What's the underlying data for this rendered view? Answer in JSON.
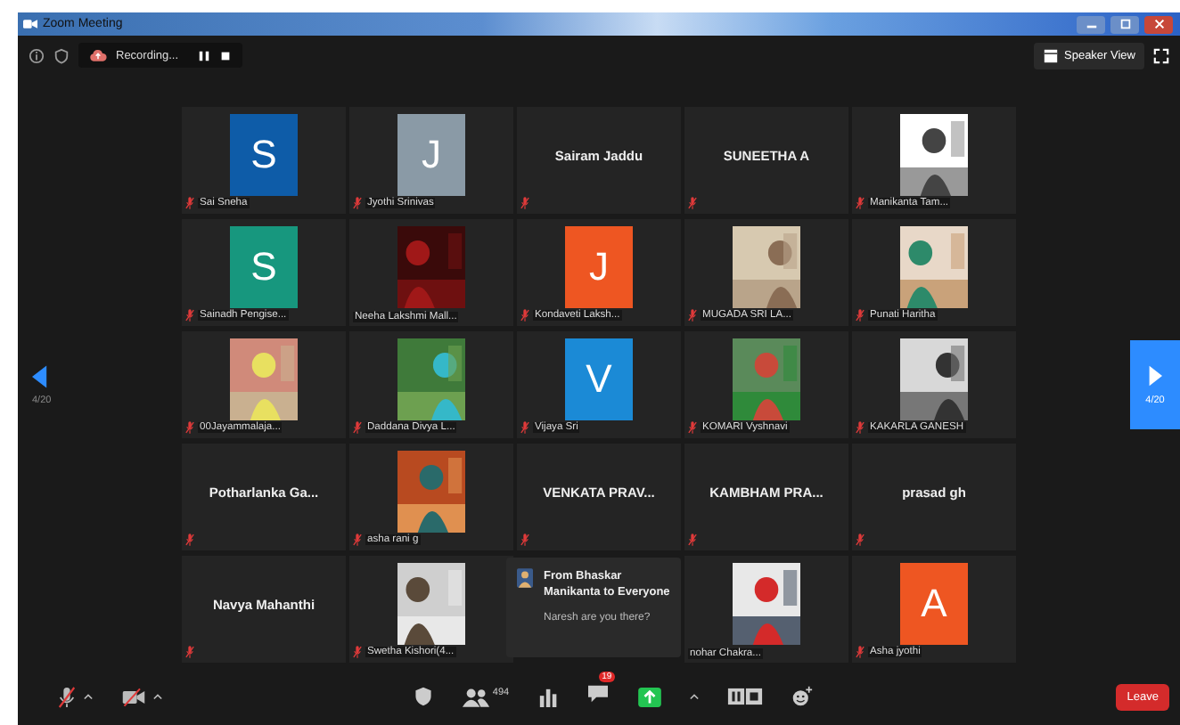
{
  "title_bar": {
    "title": "Zoom Meeting"
  },
  "top_bar": {
    "recording_label": "Recording...",
    "view_button": "Speaker View"
  },
  "pager": {
    "previous_label": "4/20",
    "next_label": "4/20"
  },
  "tiles": [
    {
      "kind": "letter",
      "letter": "S",
      "color": "#0e5ca8",
      "name": "Sai Sneha",
      "muted": true
    },
    {
      "kind": "letter",
      "letter": "J",
      "color": "#8a9aa6",
      "name": "Jyothi Srinivas",
      "muted": true
    },
    {
      "kind": "name",
      "name": "Sairam Jaddu",
      "muted": true
    },
    {
      "kind": "name",
      "name": "SUNEETHA A",
      "muted": true
    },
    {
      "kind": "picture",
      "name": "Manikanta Tam...",
      "muted": true
    },
    {
      "kind": "letter",
      "letter": "S",
      "color": "#17977e",
      "name": "Sainadh Pengise...",
      "muted": true
    },
    {
      "kind": "picture",
      "name": "Neeha Lakshmi Mall...",
      "muted": false
    },
    {
      "kind": "letter",
      "letter": "J",
      "color": "#ee5622",
      "name": "Kondaveti Laksh...",
      "muted": true
    },
    {
      "kind": "picture",
      "name": "MUGADA SRI LA...",
      "muted": true
    },
    {
      "kind": "picture",
      "name": "Punati Haritha",
      "muted": true
    },
    {
      "kind": "picture",
      "name": "00Jayammalaja...",
      "muted": true
    },
    {
      "kind": "picture",
      "name": "Daddana Divya L...",
      "muted": true
    },
    {
      "kind": "letter",
      "letter": "V",
      "color": "#1b8ad6",
      "name": "Vijaya Sri",
      "muted": true
    },
    {
      "kind": "picture",
      "name": "KOMARI Vyshnavi",
      "muted": true
    },
    {
      "kind": "picture",
      "name": "KAKARLA GANESH",
      "muted": true
    },
    {
      "kind": "name",
      "name": "Potharlanka  Ga...",
      "muted": true
    },
    {
      "kind": "picture",
      "name": "asha rani g",
      "muted": true
    },
    {
      "kind": "name",
      "name": "VENKATA PRAV...",
      "muted": true
    },
    {
      "kind": "name",
      "name": "KAMBHAM PRA...",
      "muted": true
    },
    {
      "kind": "name",
      "name": "prasad gh",
      "muted": true
    },
    {
      "kind": "name",
      "name": "Navya Mahanthi",
      "muted": true
    },
    {
      "kind": "picture",
      "name": "Swetha Kishori(4...",
      "muted": true
    },
    {
      "kind": "picture",
      "name": "nohar Chakra...",
      "muted": false
    },
    {
      "kind": "letter",
      "letter": "A",
      "color": "#ee5622",
      "name": "Asha jyothi",
      "muted": true
    }
  ],
  "chat_popup": {
    "sender": "From Bhaskar Manikanta to Everyone",
    "message": "Naresh are you there?"
  },
  "toolbar": {
    "participant_count": "494",
    "chat_badge": "19",
    "leave_label": "Leave"
  }
}
